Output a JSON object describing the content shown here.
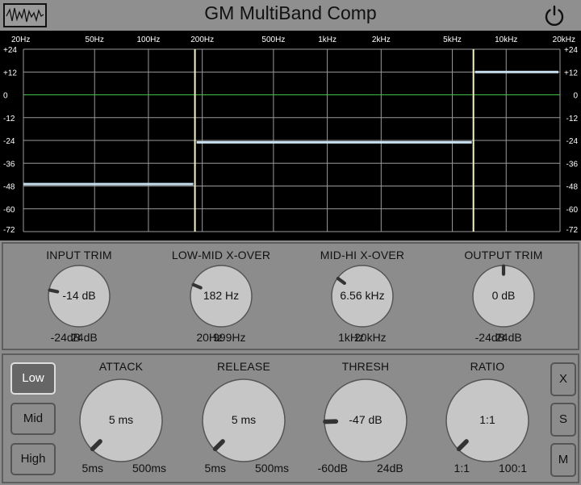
{
  "app": {
    "title": "GM MultiBand Comp"
  },
  "icons": {
    "logo": "waveform-icon",
    "power": "power-icon"
  },
  "colors": {
    "grid": "#9a9a9a",
    "zero_line": "#3fbf3f",
    "level_line": "#c8e0f0",
    "crossover": "#f4f4c8"
  },
  "graph": {
    "freq_labels": [
      "20Hz",
      "50Hz",
      "100Hz",
      "200Hz",
      "500Hz",
      "1kHz",
      "2kHz",
      "5kHz",
      "10kHz",
      "20kHz"
    ],
    "freq_values": [
      20,
      50,
      100,
      200,
      500,
      1000,
      2000,
      5000,
      10000,
      20000
    ],
    "db_labels": [
      "+24",
      "+12",
      "0",
      "-12",
      "-24",
      "-36",
      "-48",
      "-60",
      "-72"
    ],
    "db_values": [
      24,
      12,
      0,
      -12,
      -24,
      -36,
      -48,
      -60,
      -72
    ],
    "db_range": [
      -72,
      24
    ],
    "freq_range": [
      20,
      20000
    ],
    "crossovers_hz": [
      182,
      6560
    ],
    "band_levels_db": [
      -47,
      -25,
      12
    ]
  },
  "global_controls": [
    {
      "label": "INPUT TRIM",
      "value": "-14 dB",
      "min": "-24dB",
      "max": "24dB",
      "fraction": 0.21
    },
    {
      "label": "LOW-MID X-OVER",
      "value": "182 Hz",
      "min": "20Hz",
      "max": "999Hz",
      "fraction": 0.25
    },
    {
      "label": "MID-HI X-OVER",
      "value": "6.56 kHz",
      "min": "1kHz",
      "max": "20kHz",
      "fraction": 0.3
    },
    {
      "label": "OUTPUT TRIM",
      "value": "0 dB",
      "min": "-24dB",
      "max": "24dB",
      "fraction": 0.5
    }
  ],
  "band_buttons": [
    "Low",
    "Mid",
    "High"
  ],
  "selected_band": "Low",
  "band_controls": [
    {
      "label": "ATTACK",
      "value": "5 ms",
      "min": "5ms",
      "max": "500ms",
      "fraction": 0.0
    },
    {
      "label": "RELEASE",
      "value": "5 ms",
      "min": "5ms",
      "max": "500ms",
      "fraction": 0.0
    },
    {
      "label": "THRESH",
      "value": "-47 dB",
      "min": "-60dB",
      "max": "24dB",
      "fraction": 0.16
    },
    {
      "label": "RATIO",
      "value": "1:1",
      "min": "1:1",
      "max": "100:1",
      "fraction": 0.0
    }
  ],
  "side_buttons": [
    "X",
    "S",
    "M"
  ]
}
